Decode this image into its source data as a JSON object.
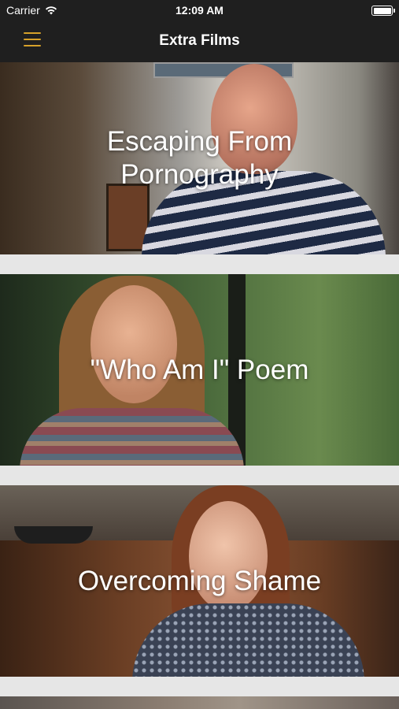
{
  "status_bar": {
    "carrier": "Carrier",
    "time": "12:09 AM"
  },
  "nav": {
    "title": "Extra Films"
  },
  "films": [
    {
      "title": "Escaping From\nPornography"
    },
    {
      "title": "\"Who Am I\" Poem"
    },
    {
      "title": "Overcoming Shame"
    }
  ],
  "colors": {
    "bar_background": "#1f1f1f",
    "menu_accent": "#d6a12a",
    "separator": "#e6e6e6"
  }
}
